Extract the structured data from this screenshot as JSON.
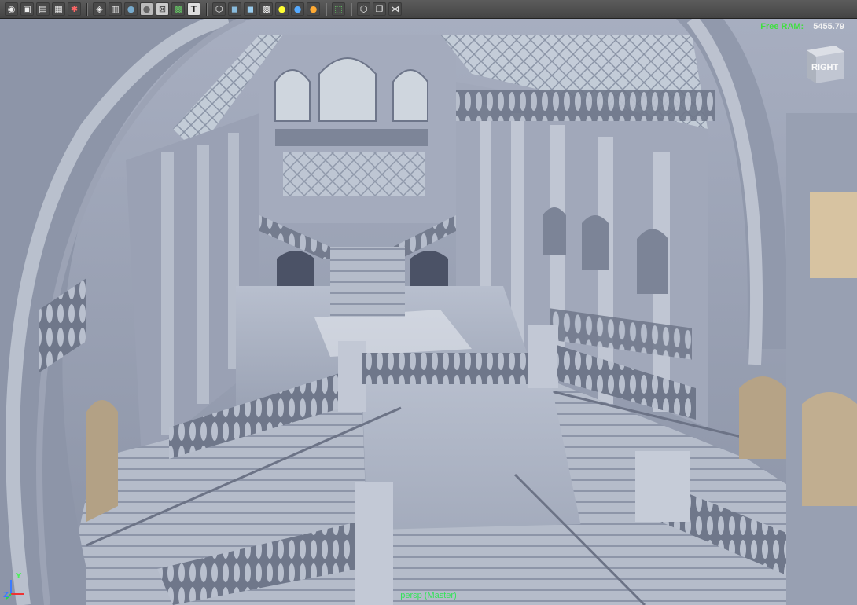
{
  "toolbar": {
    "icons": [
      "camera-attributes-icon",
      "camera-bookmark-icon",
      "image-plane-icon",
      "grid-icon",
      "film-gate-icon",
      "shaded-mode-icon",
      "wireframe-mode-icon",
      "default-lighting-icon",
      "smooth-shade-icon",
      "xray-icon",
      "textured-icon",
      "text-icon",
      "isolate-select-icon",
      "shaded-cube-icon",
      "textured-cube-icon",
      "checker-icon",
      "light-bulb-yellow-icon",
      "light-bulb-blue-icon",
      "light-bulb-orange-icon",
      "select-tool-icon",
      "cube-icon",
      "duplicate-icon",
      "share-icon"
    ]
  },
  "hud": {
    "ram_label": "Free RAM:",
    "ram_value": "5455.79",
    "camera_label": "persp (Master)",
    "viewcube_label": "RIGHT",
    "axis_y": "Y",
    "axis_z": "Z"
  },
  "colors": {
    "ram_label": "#3fe03f",
    "camera_label": "#35e35a",
    "viewport_bg": "#8e96a8"
  }
}
